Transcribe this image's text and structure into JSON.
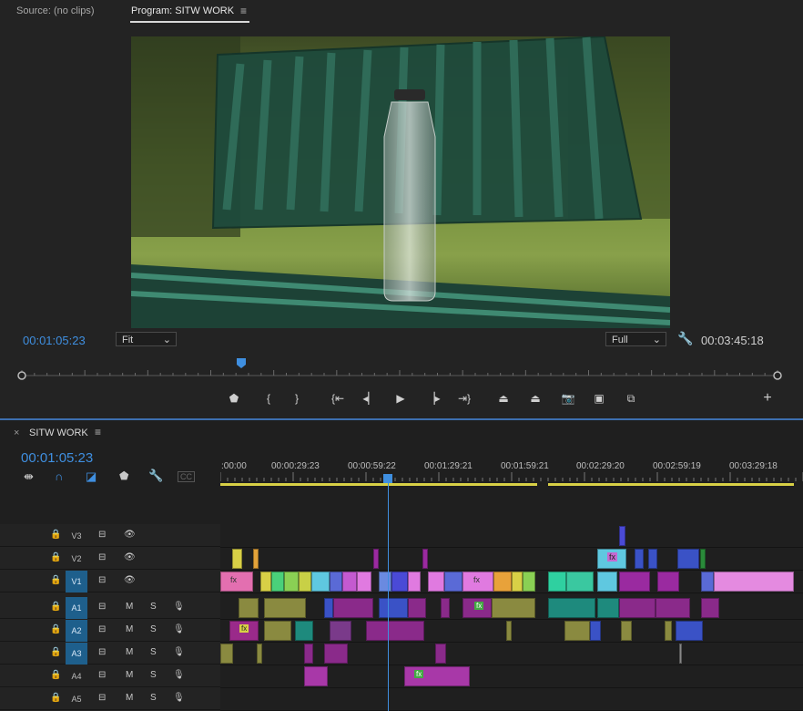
{
  "monitor": {
    "source_tab": "Source: (no clips)",
    "program_tab": "Program: SITW WORK",
    "current_timecode": "00:01:05:23",
    "fit_select": "Fit",
    "resolution_select": "Full",
    "duration_timecode": "00:03:45:18",
    "playhead_fraction": 0.29
  },
  "timeline": {
    "sequence_name": "SITW WORK",
    "timecode": "00:01:05:23",
    "ruler_labels": [
      ":00:00",
      "00:00:29:23",
      "00:00:59:22",
      "00:01:29:21",
      "00:01:59:21",
      "00:02:29:20",
      "00:02:59:19",
      "00:03:29:18"
    ],
    "video_tracks": [
      "V3",
      "V2",
      "V1"
    ],
    "audio_tracks": [
      "A1",
      "A2",
      "A3",
      "A4",
      "A5"
    ],
    "mute_label": "M",
    "solo_label": "S",
    "fx_label": "fx"
  },
  "colors": {
    "accent": "#3f8fe0",
    "work_area": "#d8d046",
    "magenta": "#9a2aa0",
    "pink": "#e36fb0",
    "teal": "#1e8a7d",
    "blue": "#3a52c6"
  }
}
